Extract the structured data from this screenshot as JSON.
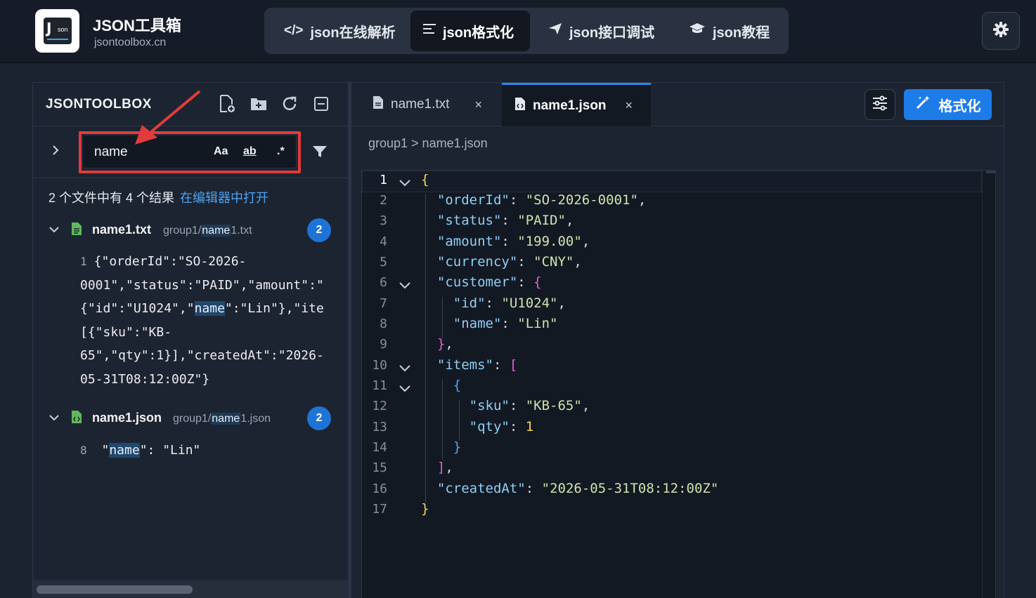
{
  "app": {
    "title": "JSON工具箱",
    "subtitle": "jsontoolbox.cn",
    "logo_text": "Json"
  },
  "nav": {
    "items": [
      {
        "label": "json在线解析",
        "icon": "code-icon"
      },
      {
        "label": "json格式化",
        "icon": "align-left-icon",
        "active": true
      },
      {
        "label": "json接口调试",
        "icon": "send-icon"
      },
      {
        "label": "json教程",
        "icon": "graduation-cap-icon"
      }
    ],
    "settings_icon": "gear-icon"
  },
  "explorer": {
    "title": "JSONTOOLBOX",
    "tools": [
      "new-file-icon",
      "new-folder-icon",
      "refresh-icon",
      "collapse-all-icon"
    ]
  },
  "search": {
    "value": "name",
    "options": {
      "case": "Aa",
      "word": "ab",
      "regex": ".*"
    },
    "highlight_color": "#e23b3b"
  },
  "results": {
    "summary": "2 个文件中有 4 个结果",
    "open_link": "在编辑器中打开",
    "files": [
      {
        "name": "name1.txt",
        "path_prefix": "group1/",
        "path_match": "name",
        "path_suffix": "1.txt",
        "count": "2",
        "match_line_no": "1",
        "match_lines": [
          "{\"orderId\":\"SO-2026-",
          "0001\",\"status\":\"PAID\",\"amount\":\"",
          "{\"id\":\"U1024\",\"",
          "[{\"sku\":\"KB-",
          "65\",\"qty\":1}],\"createdAt\":\"2026-",
          "05-31T08:12:00Z\"}"
        ],
        "line3_match": "name",
        "line3_tail": "\":\"Lin\"},\"ite"
      },
      {
        "name": "name1.json",
        "path_prefix": "group1/",
        "path_match": "name",
        "path_suffix": "1.json",
        "count": "2",
        "match_line_no": "8",
        "match_pre": "\"",
        "match_hit": "name",
        "match_post": "\": \"Lin\""
      }
    ]
  },
  "editor": {
    "tabs": [
      {
        "label": "name1.txt",
        "close": "×"
      },
      {
        "label": "name1.json",
        "close": "×",
        "active": true
      }
    ],
    "format_button": "格式化",
    "adjust_icon": "sliders-icon",
    "breadcrumb": "group1 > name1.json",
    "accent": "#1e7ce8",
    "line_numbers": [
      "1",
      "2",
      "3",
      "4",
      "5",
      "6",
      "7",
      "8",
      "9",
      "10",
      "11",
      "12",
      "13",
      "14",
      "15",
      "16",
      "17"
    ],
    "code": {
      "l1": "{",
      "l2k": "\"orderId\"",
      "l2v": "\"SO-2026-0001\"",
      "l3k": "\"status\"",
      "l3v": "\"PAID\"",
      "l4k": "\"amount\"",
      "l4v": "\"199.00\"",
      "l5k": "\"currency\"",
      "l5v": "\"CNY\"",
      "l6k": "\"customer\"",
      "l6b": "{",
      "l7k": "\"id\"",
      "l7v": "\"U1024\"",
      "l8k": "\"name\"",
      "l8v": "\"Lin\"",
      "l9b": "}",
      "l10k": "\"items\"",
      "l10b": "[",
      "l11b": "{",
      "l12k": "\"sku\"",
      "l12v": "\"KB-65\"",
      "l13k": "\"qty\"",
      "l13v": "1",
      "l14b": "}",
      "l15b": "]",
      "l16k": "\"createdAt\"",
      "l16v": "\"2026-05-31T08:12:00Z\"",
      "l17": "}"
    }
  }
}
